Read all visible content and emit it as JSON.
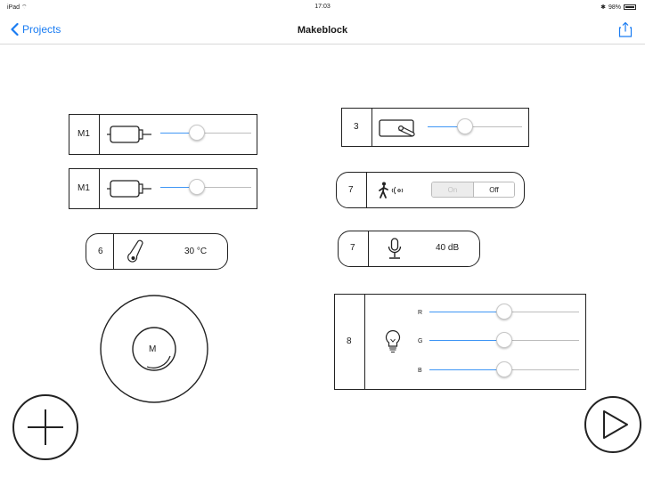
{
  "status": {
    "device": "iPad",
    "time": "17:03",
    "battery": "98%"
  },
  "nav": {
    "back_label": "Projects",
    "title": "Makeblock"
  },
  "motor1": {
    "port": "M1",
    "icon": "dc-motor-icon",
    "value": 0.4
  },
  "motor2": {
    "port": "M1",
    "icon": "dc-motor-icon",
    "value": 0.4
  },
  "temperature": {
    "port": "6",
    "icon": "thermometer-icon",
    "reading": "30 °C"
  },
  "joystick": {
    "label": "M"
  },
  "servo": {
    "port": "3",
    "icon": "servo-icon",
    "value": 0.4
  },
  "pir": {
    "port": "7",
    "icon": "motion-sensor-icon",
    "on_label": "On",
    "off_label": "Off",
    "state": "Off"
  },
  "sound": {
    "port": "7",
    "icon": "microphone-icon",
    "reading": "40 dB"
  },
  "rgb": {
    "port": "8",
    "icon": "light-bulb-icon",
    "channels": [
      {
        "label": "R",
        "value": 0.5
      },
      {
        "label": "G",
        "value": 0.5
      },
      {
        "label": "B",
        "value": 0.5
      }
    ]
  },
  "colors": {
    "accent": "#1a7cf2",
    "slider_fill": "#3f96f5",
    "border": "#222222"
  }
}
